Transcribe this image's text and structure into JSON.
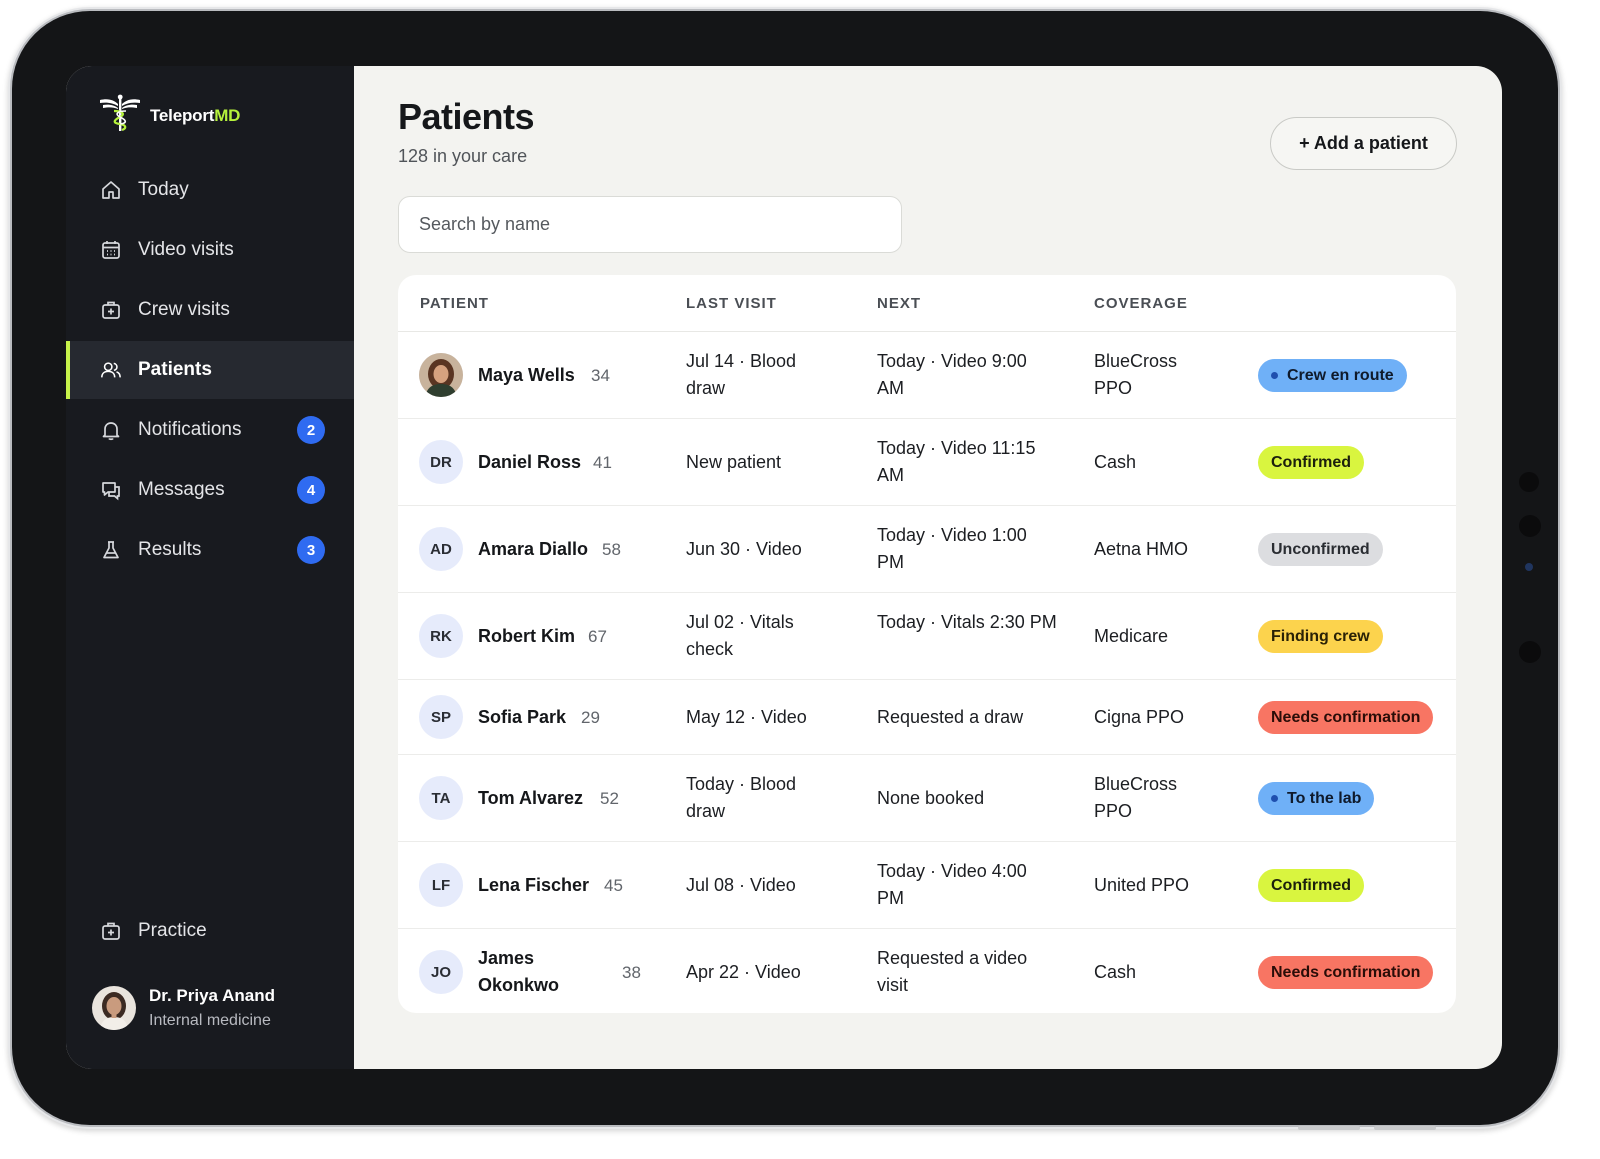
{
  "app": {
    "logo_main": "Teleport",
    "logo_accent": "MD"
  },
  "sidebar": {
    "items": [
      {
        "label": "Today",
        "icon": "home-icon"
      },
      {
        "label": "Video visits",
        "icon": "calendar-icon"
      },
      {
        "label": "Crew visits",
        "icon": "medical-kit-icon"
      },
      {
        "label": "Patients",
        "icon": "users-icon",
        "active": true
      },
      {
        "label": "Notifications",
        "icon": "bell-icon",
        "badge": "2"
      },
      {
        "label": "Messages",
        "icon": "chat-icon",
        "badge": "4"
      },
      {
        "label": "Results",
        "icon": "flask-icon",
        "badge": "3"
      }
    ],
    "practice_label": "Practice",
    "user": {
      "name": "Dr. Priya Anand",
      "role": "Internal medicine"
    }
  },
  "main": {
    "title": "Patients",
    "subtitle": "128 in your care",
    "add_button": "+ Add a patient",
    "search_placeholder": "Search by name"
  },
  "table": {
    "columns": [
      "PATIENT",
      "LAST VISIT",
      "NEXT",
      "COVERAGE"
    ],
    "rows": [
      {
        "initials": "",
        "photo": true,
        "name": "Maya Wells",
        "age": "34",
        "last_visit": "Jul 14 · Blood draw",
        "next": "Today · Video 9:00 AM",
        "coverage": "BlueCross PPO",
        "status": "Crew en route",
        "status_style": "blue"
      },
      {
        "initials": "DR",
        "name": "Daniel Ross",
        "age": "41",
        "last_visit": "New patient",
        "next": "Today · Video 11:15 AM",
        "coverage": "Cash",
        "status": "Confirmed",
        "status_style": "lime"
      },
      {
        "initials": "AD",
        "name": "Amara Diallo",
        "age": "58",
        "last_visit": "Jun 30 · Video",
        "next": "Today · Video 1:00 PM",
        "coverage": "Aetna HMO",
        "status": "Unconfirmed",
        "status_style": "gray"
      },
      {
        "initials": "RK",
        "name": "Robert Kim",
        "age": "67",
        "last_visit": "Jul 02 · Vitals check",
        "next": "Today · Vitals 2:30 PM",
        "coverage": "Medicare",
        "status": "Finding crew",
        "status_style": "yellow"
      },
      {
        "initials": "SP",
        "name": "Sofia Park",
        "age": "29",
        "last_visit": "May 12 · Video",
        "next": "Requested a draw",
        "coverage": "Cigna PPO",
        "status": "Needs confirmation",
        "status_style": "red"
      },
      {
        "initials": "TA",
        "name": "Tom Alvarez",
        "age": "52",
        "last_visit": "Today · Blood draw",
        "next": "None booked",
        "coverage": "BlueCross PPO",
        "status": "To the lab",
        "status_style": "blue"
      },
      {
        "initials": "LF",
        "name": "Lena Fischer",
        "age": "45",
        "last_visit": "Jul 08 · Video",
        "next": "Today · Video 4:00 PM",
        "coverage": "United PPO",
        "status": "Confirmed",
        "status_style": "lime"
      },
      {
        "initials": "JO",
        "name": "James Okonkwo",
        "age": "38",
        "last_visit": "Apr 22 · Video",
        "next": "Requested a video visit",
        "coverage": "Cash",
        "status": "Needs confirmation",
        "status_style": "red"
      }
    ]
  },
  "colors": {
    "sidebar_bg": "#181a1f",
    "accent_lime": "#c7f24a",
    "badge_blue": "#2f6bf1",
    "page_bg": "#f3f3f0"
  }
}
